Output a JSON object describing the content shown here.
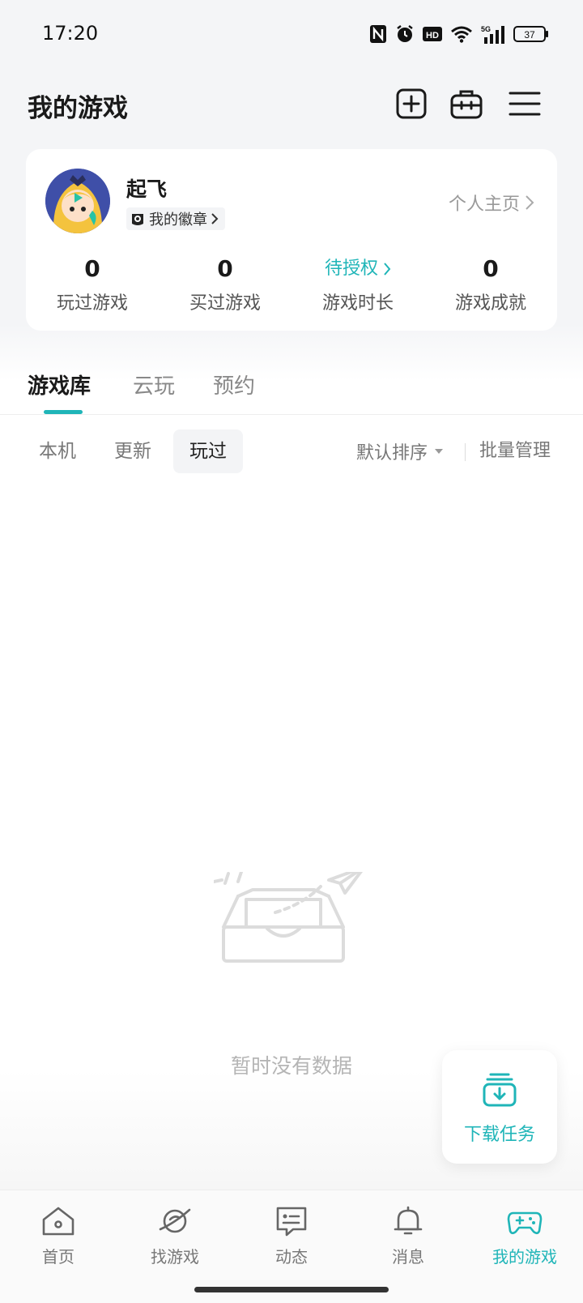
{
  "status_bar": {
    "time": "17:20",
    "network": "5G",
    "battery": "37",
    "icons": [
      "nfc-icon",
      "alarm-icon",
      "hd-icon",
      "wifi-icon",
      "signal-icon",
      "battery-icon"
    ]
  },
  "header": {
    "title": "我的游戏",
    "actions": [
      "add-game-icon",
      "toolbox-icon",
      "menu-icon"
    ]
  },
  "profile": {
    "username": "起飞",
    "badge_label": "我的徽章",
    "homepage_label": "个人主页",
    "stats": [
      {
        "value": "0",
        "label": "玩过游戏"
      },
      {
        "value": "0",
        "label": "买过游戏"
      },
      {
        "value": "待授权",
        "label": "游戏时长"
      },
      {
        "value": "0",
        "label": "游戏成就"
      }
    ]
  },
  "tabs": [
    "游戏库",
    "云玩",
    "预约"
  ],
  "active_tab": "游戏库",
  "subtabs": [
    "本机",
    "更新",
    "玩过"
  ],
  "active_subtab": "玩过",
  "sort_label": "默认排序",
  "batch_label": "批量管理",
  "empty_text": "暂时没有数据",
  "download_task_label": "下载任务",
  "bottom_nav": [
    {
      "label": "首页",
      "icon": "home-icon"
    },
    {
      "label": "找游戏",
      "icon": "planet-icon"
    },
    {
      "label": "动态",
      "icon": "chat-icon"
    },
    {
      "label": "消息",
      "icon": "bell-icon"
    },
    {
      "label": "我的游戏",
      "icon": "gamepad-icon"
    }
  ],
  "active_nav": "我的游戏",
  "colors": {
    "accent": "#1fb5b8",
    "background": "#f4f5f7",
    "card": "#ffffff"
  }
}
